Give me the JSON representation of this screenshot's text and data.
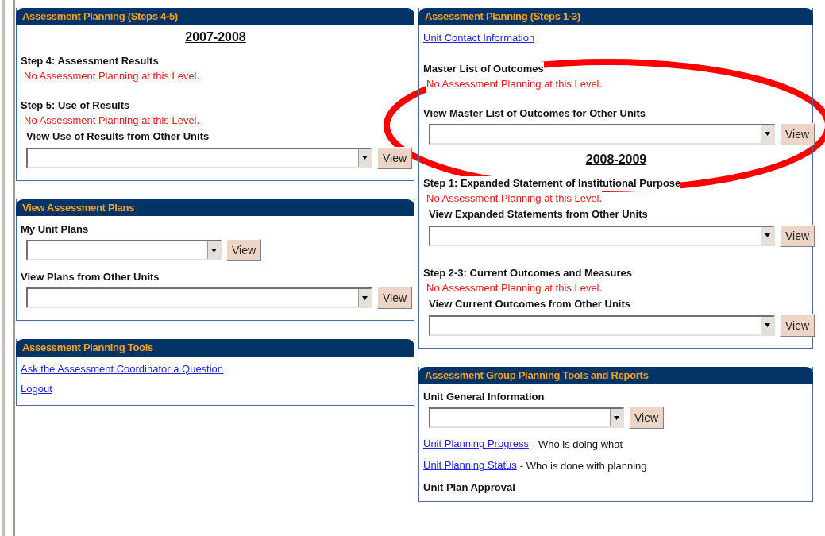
{
  "columns": [
    {
      "panels": [
        {
          "title": "Assessment Planning (Steps 4-5)",
          "items": [
            {
              "kind": "year",
              "text": "2007-2008"
            },
            {
              "kind": "heading",
              "text": "Step 4: Assessment Results"
            },
            {
              "kind": "notice",
              "text": "No Assessment Planning at this Level."
            },
            {
              "kind": "heading",
              "text": "Step 5: Use of Results"
            },
            {
              "kind": "notice",
              "text": "No Assessment Planning at this Level."
            },
            {
              "kind": "sublabel",
              "text": "View Use of Results from Other Units"
            },
            {
              "kind": "select",
              "button": "View"
            }
          ]
        },
        {
          "title": "View Assessment Plans",
          "items": [
            {
              "kind": "heading",
              "text": "My Unit Plans"
            },
            {
              "kind": "short_select",
              "button": "View"
            },
            {
              "kind": "heading",
              "text": "View Plans from Other Units"
            },
            {
              "kind": "select",
              "button": "View"
            }
          ]
        },
        {
          "title": "Assessment Planning Tools",
          "items": [
            {
              "kind": "link",
              "text": "Ask the Assessment Coordinator a Question"
            },
            {
              "kind": "link",
              "text": "Logout"
            }
          ]
        }
      ]
    },
    {
      "panels": [
        {
          "title": "Assessment Planning (Steps 1-3)",
          "items": [
            {
              "kind": "link",
              "text": "Unit Contact Information"
            },
            {
              "kind": "heading",
              "text": "Master List of Outcomes"
            },
            {
              "kind": "notice",
              "text": "No Assessment Planning at this Level."
            },
            {
              "kind": "heading",
              "text": "View Master List of Outcomes for Other Units"
            },
            {
              "kind": "select",
              "button": "View"
            },
            {
              "kind": "year",
              "text": "2008-2009"
            },
            {
              "kind": "heading",
              "text": "Step 1: Expanded Statement of Institutional Purpose"
            },
            {
              "kind": "notice",
              "text": "No Assessment Planning at this Level."
            },
            {
              "kind": "sublabel",
              "text": "View Expanded Statements from Other Units"
            },
            {
              "kind": "select",
              "button": "View"
            },
            {
              "kind": "heading",
              "text": "Step 2-3: Current Outcomes and Measures"
            },
            {
              "kind": "notice",
              "text": "No Assessment Planning at this Level."
            },
            {
              "kind": "sublabel",
              "text": "View Current Outcomes from Other Units"
            },
            {
              "kind": "select",
              "button": "View"
            }
          ]
        },
        {
          "title": "Assessment Group Planning Tools and Reports",
          "items": [
            {
              "kind": "heading",
              "text": "Unit General Information"
            },
            {
              "kind": "short_select",
              "button": "View"
            },
            {
              "kind": "link_note",
              "text": "Unit Planning Progress",
              "note": "- Who is doing what"
            },
            {
              "kind": "link_note",
              "text": "Unit Planning Status",
              "note": "- Who is done with planning"
            },
            {
              "kind": "heading",
              "text": "Unit Plan Approval"
            }
          ]
        }
      ]
    }
  ],
  "annotation": {
    "kind": "ellipse"
  }
}
